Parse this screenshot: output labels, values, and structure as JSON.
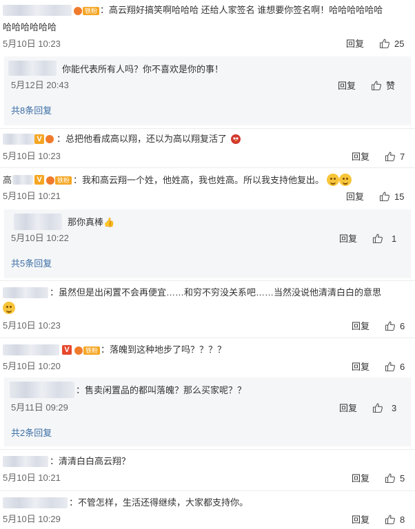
{
  "labels": {
    "reply": "回复",
    "like": "赞"
  },
  "comments": [
    {
      "text": "：高云翔好搞笑啊哈哈哈 还给人家签名 谁想要你签名啊！哈哈哈哈哈哈",
      "text2": "哈哈哈哈哈哈",
      "date": "5月10日 10:23",
      "likes": "25"
    },
    {
      "text": "：总把他看成高以翔，还以为高以翔复活了",
      "date": "5月10日 10:23",
      "likes": "7"
    },
    {
      "name_prefix": "高",
      "text": "：我和高云翔一个姓，他姓高，我也姓高。所以我支持他复出。",
      "date": "5月10日 10:21",
      "likes": "15"
    },
    {
      "text": "：虽然但是出闲置不会再便宜……和穷不穷没关系吧……当然没说他清清白白的意思",
      "date": "5月10日 10:23",
      "likes": "6"
    },
    {
      "text": "：落魄到这种地步了吗？？？？",
      "date": "5月10日 10:20",
      "likes": "6"
    },
    {
      "text": "：清清白白高云翔？",
      "date": "5月10日 10:21",
      "likes": "5"
    },
    {
      "text": "：不管怎样，生活还得继续，大家都支持你。",
      "date": "5月10日 10:29",
      "likes": "8"
    }
  ],
  "subreplies": [
    {
      "text": "你能代表所有人吗？你不喜欢是你的事！",
      "date": "5月12日 20:43",
      "likes": "赞",
      "more": "共8条回复"
    },
    {
      "text": "那你真棒",
      "date": "5月10日 10:22",
      "likes": "1",
      "more": "共5条回复"
    },
    {
      "text": "：售卖闲置品的都叫落魄？那么买家呢？？",
      "date": "5月11日 09:29",
      "likes": "3",
      "more": "共2条回复"
    }
  ],
  "badges": {
    "fan_tag": "铁粉",
    "v": "V"
  },
  "colors": {
    "link": "#3b6ea5",
    "subbox_bg": "#f5f6f8",
    "v_orange": "#f5a623",
    "v_red": "#e6492d"
  }
}
